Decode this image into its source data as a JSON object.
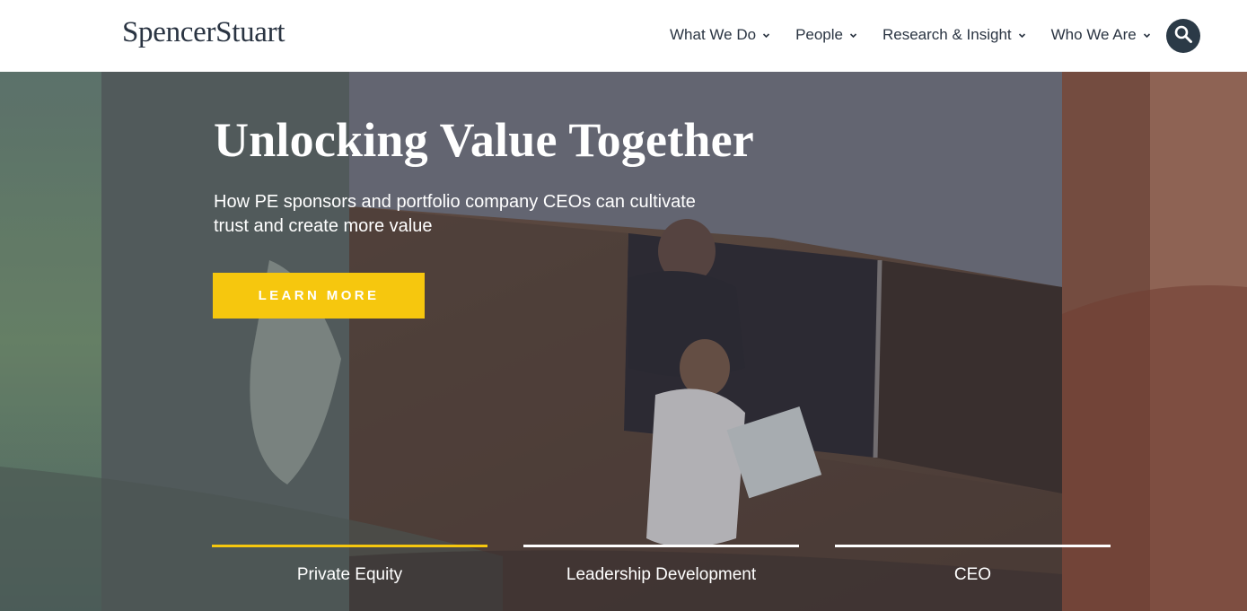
{
  "header": {
    "logo": "SpencerStuart",
    "nav": [
      {
        "label": "What We Do"
      },
      {
        "label": "People"
      },
      {
        "label": "Research & Insight"
      },
      {
        "label": "Who We Are"
      }
    ],
    "search_icon": "search-icon"
  },
  "hero": {
    "title": "Unlocking Value Together",
    "subtitle": "How PE sponsors and portfolio company CEOs can cultivate trust and create more value",
    "cta_label": "LEARN MORE",
    "tabs": [
      {
        "label": "Private Equity",
        "active": true
      },
      {
        "label": "Leadership Development",
        "active": false
      },
      {
        "label": "CEO",
        "active": false
      }
    ]
  },
  "colors": {
    "brand_text": "#2a3442",
    "accent_yellow": "#f6c70e",
    "search_bg": "#2b3a47"
  }
}
